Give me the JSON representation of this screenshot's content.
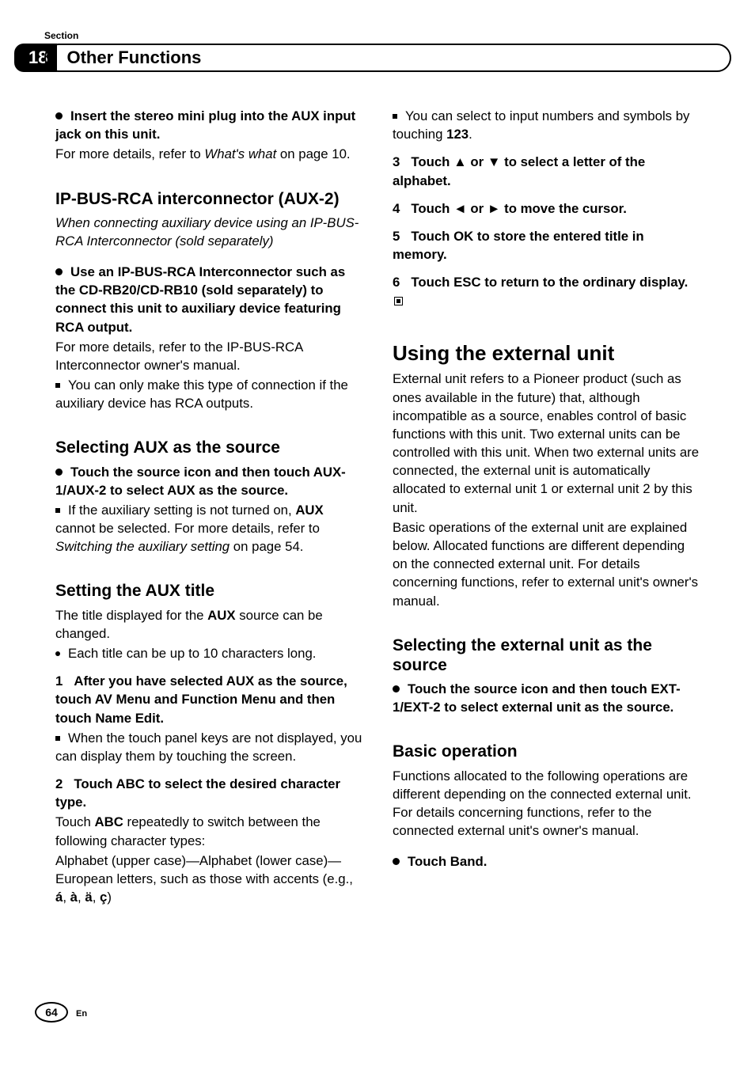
{
  "header": {
    "sectionLabel": "Section",
    "sectionNum": "18",
    "title": "Other Functions"
  },
  "left": {
    "insertStereo": {
      "lead": "Insert the stereo mini plug into the AUX input jack on this unit.",
      "body1a": "For more details, refer to ",
      "body1b": "What's what",
      "body1c": " on page 10."
    },
    "ipbus": {
      "heading": "IP-BUS-RCA interconnector (AUX-2)",
      "ital": "When connecting auxiliary device using an IP-BUS-RCA Interconnector (sold separately)",
      "lead": "Use an IP-BUS-RCA Interconnector such as the CD-RB20/CD-RB10 (sold separately) to connect this unit to auxiliary device featuring RCA output.",
      "body1": "For more details, refer to the IP-BUS-RCA Interconnector owner's manual.",
      "note": "You can only make this type of connection if the auxiliary device has RCA outputs."
    },
    "selectAux": {
      "heading": "Selecting AUX as the source",
      "lead": "Touch the source icon and then touch AUX-1/AUX-2 to select AUX as the source.",
      "note1a": "If the auxiliary setting is not turned on, ",
      "note1b": "AUX",
      "note1c": " cannot be selected. For more details, refer to ",
      "note1d": "Switching the auxiliary setting",
      "note1e": " on page 54."
    },
    "setTitle": {
      "heading": "Setting the AUX title",
      "body1a": "The title displayed for the ",
      "body1b": "AUX",
      "body1c": " source can be changed.",
      "bullet1": "Each title can be up to 10 characters long.",
      "step1": "After you have selected AUX as the source, touch AV Menu and Function Menu and then touch Name Edit.",
      "step1note": "When the touch panel keys are not displayed, you can display them by touching the screen.",
      "step2": "Touch ABC to select the desired character type.",
      "step2body1a": "Touch ",
      "step2body1b": "ABC",
      "step2body1c": " repeatedly to switch between the following character types:",
      "step2body2a": "Alphabet (upper case)—Alphabet (lower case)—European letters, such as those with accents (e.g., ",
      "step2body2b": "á",
      "step2body2c": ", ",
      "step2body2d": "à",
      "step2body2e": ", ",
      "step2body2f": "ä",
      "step2body2g": ", ",
      "step2body2h": "ç",
      "step2body2i": ")"
    }
  },
  "right": {
    "topNote1a": "You can select to input numbers and symbols by touching ",
    "topNote1b": "123",
    "topNote1c": ".",
    "step3a": "Touch ",
    "step3b": "▲",
    "step3c": " or ",
    "step3d": "▼",
    "step3e": " to select a letter of the alphabet.",
    "step4a": "Touch ",
    "step4b": "◄",
    "step4c": " or ",
    "step4d": "►",
    "step4e": " to move the cursor.",
    "step5": "Touch OK to store the entered title in memory.",
    "step6": "Touch ESC to return to the ordinary display.",
    "ext": {
      "heading": "Using the external unit",
      "para1": "External unit refers to a Pioneer product (such as ones available in the future) that, although incompatible as a source, enables control of basic functions with this unit. Two external units can be controlled with this unit. When two external units are connected, the external unit is automatically allocated to external unit 1 or external unit 2 by this unit.",
      "para2": "Basic operations of the external unit are explained below. Allocated functions are different depending on the connected external unit. For details concerning functions, refer to external unit's owner's manual."
    },
    "selExt": {
      "heading": "Selecting the external unit as the source",
      "lead": "Touch the source icon and then touch EXT-1/EXT-2 to select external unit as the source."
    },
    "basic": {
      "heading": "Basic operation",
      "body": "Functions allocated to the following operations are different depending on the connected external unit. For details concerning functions, refer to the connected external unit's owner's manual.",
      "lead": "Touch Band."
    }
  },
  "footer": {
    "pageNum": "64",
    "lang": "En"
  },
  "labels": {
    "step1": "1",
    "step2": "2",
    "step3": "3",
    "step4": "4",
    "step5": "5",
    "step6": "6"
  }
}
